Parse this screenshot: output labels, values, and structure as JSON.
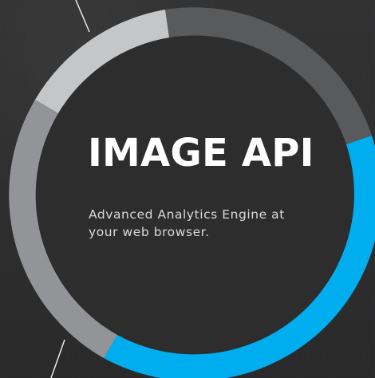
{
  "hero": {
    "title": "IMAGE API",
    "subtitle": "Advanced Analytics Engine at\nyour web browser."
  },
  "ring_segments": [
    {
      "name": "dark-gray-segment",
      "color": "#595a5c"
    },
    {
      "name": "blue-segment",
      "color": "#00aeef"
    },
    {
      "name": "mid-gray-segment",
      "color": "#939497"
    },
    {
      "name": "light-gray-segment",
      "color": "#c5c6c8"
    }
  ],
  "theme": {
    "background": "#2f2f30",
    "center_fill": "#2d2d2e",
    "title_color": "#ffffff",
    "subtitle_color": "#d9d9d9",
    "accent": "#00aeef"
  }
}
